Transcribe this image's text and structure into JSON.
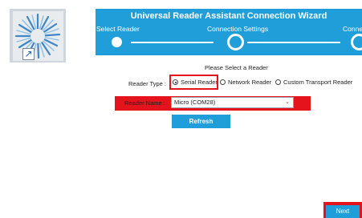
{
  "desktop": {
    "shortcut_icon": "sunburst-app-icon",
    "overlay_icon": "shortcut-arrow-icon"
  },
  "wizard": {
    "title": "Universal Reader Assistant Connection Wizard",
    "steps": [
      {
        "label": "Select Reader",
        "state": "completed"
      },
      {
        "label": "Connection Settings",
        "state": "current"
      },
      {
        "label": "Connect/",
        "state": "upcoming"
      }
    ]
  },
  "form": {
    "prompt": "Please Select a Reader",
    "reader_type_label": "Reader Type :",
    "reader_type_options": [
      "Serial Reader",
      "Network Reader",
      "Custom Transport Reader"
    ],
    "reader_type_selected": "Serial Reader",
    "reader_name_label": "Reader Name :",
    "reader_name_value": "Micro (COM28)",
    "refresh_label": "Refresh"
  },
  "footer": {
    "next_label": "Next"
  },
  "colors": {
    "accent": "#1f9ed9",
    "highlight": "#e5141c"
  }
}
